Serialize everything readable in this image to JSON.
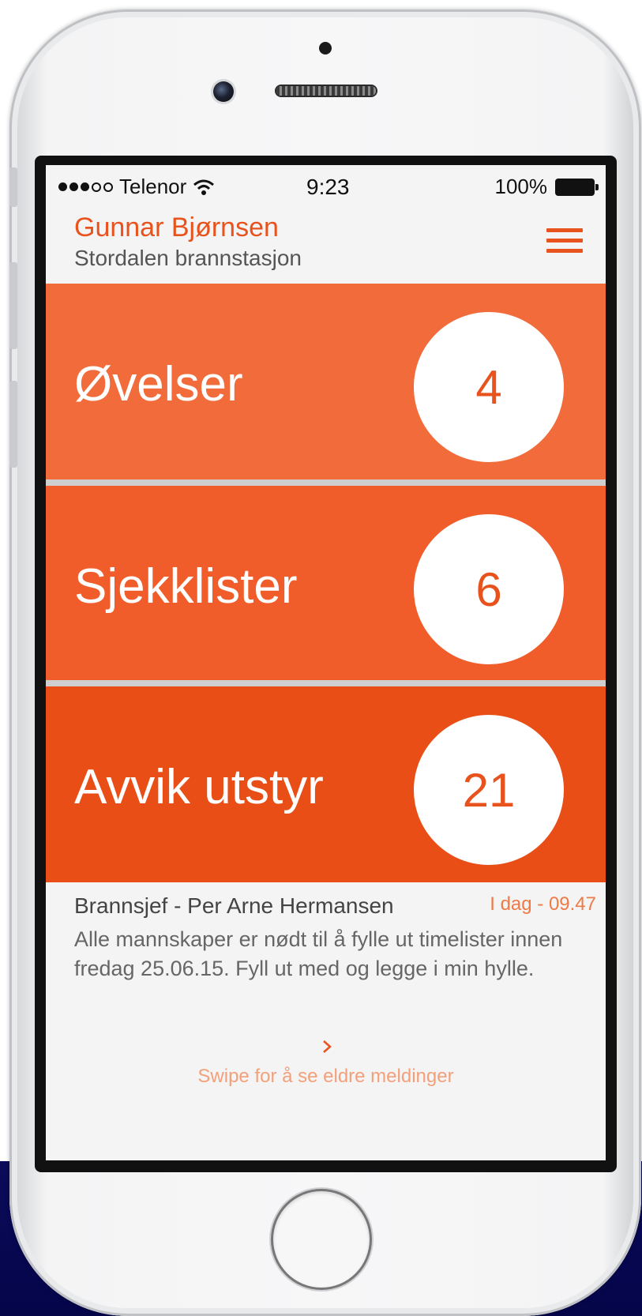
{
  "status_bar": {
    "carrier": "Telenor",
    "time": "9:23",
    "battery": "100%"
  },
  "header": {
    "user_name": "Gunnar Bjørnsen",
    "station": "Stordalen brannstasjon"
  },
  "tiles": [
    {
      "label": "Øvelser",
      "count": "4",
      "color": "#f26c3b"
    },
    {
      "label": "Sjekklister",
      "count": "6",
      "color": "#f15d2a"
    },
    {
      "label": "Avvik utstyr",
      "count": "21",
      "color": "#e84e16"
    }
  ],
  "message": {
    "from": "Brannsjef - Per Arne Hermansen",
    "time": "I dag - 09.47",
    "body": "Alle mannskaper er nødt til å fylle ut timelister innen fredag 25.06.15. Fyll ut med og legge i min hylle.",
    "swipe_hint": "Swipe for å se eldre meldinger"
  },
  "colors": {
    "accent": "#e8531d",
    "tile1": "#f26c3b",
    "tile2": "#f15d2a",
    "tile3": "#e84e16"
  }
}
